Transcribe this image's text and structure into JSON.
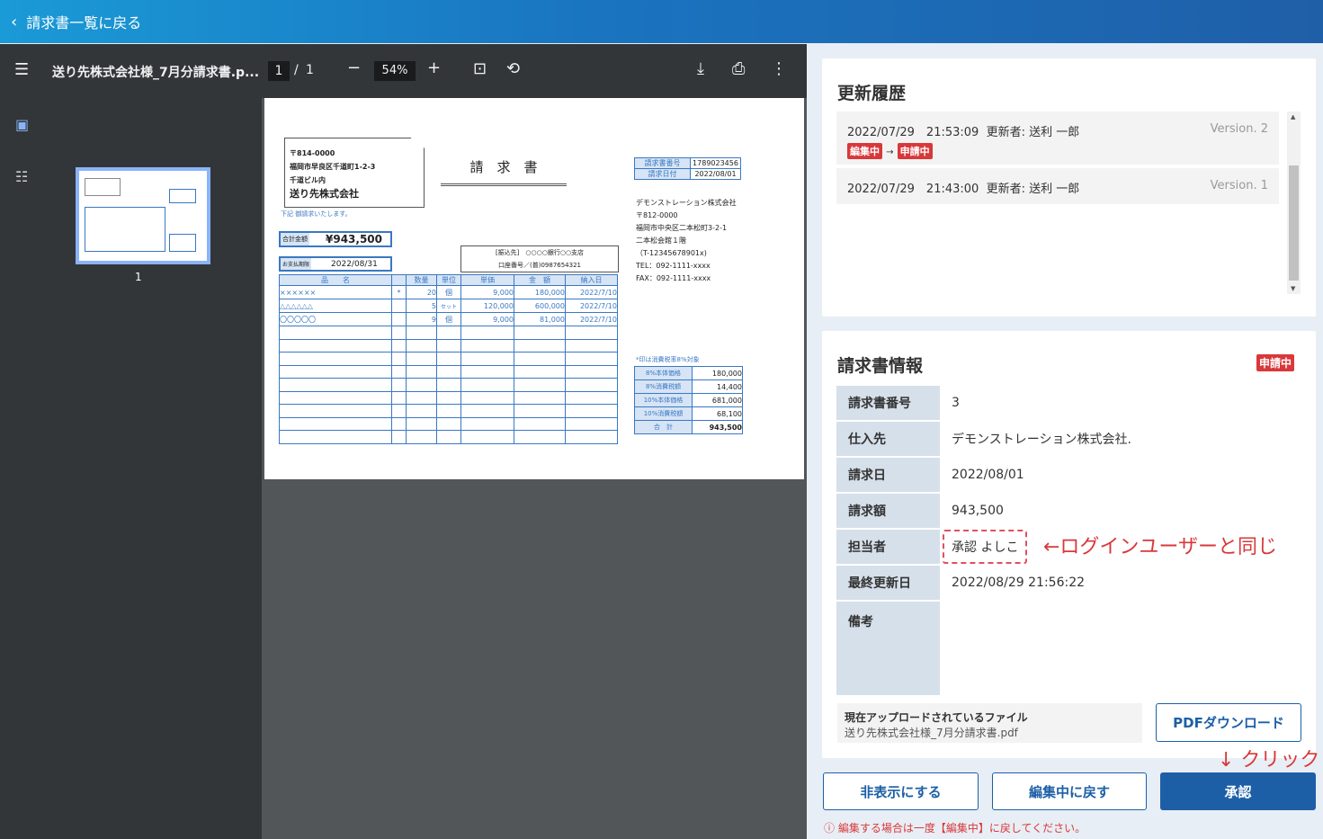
{
  "header": {
    "back_label": "請求書一覧に戻る"
  },
  "viewer": {
    "filename": "送り先株式会社様_7月分請求書.p...",
    "page": "1",
    "page_sep": "/",
    "total": "1",
    "zoom": "54%",
    "thumb_no": "1"
  },
  "invoice": {
    "postal": "〒814-0000",
    "addr1": "福岡市早良区千道町1-2-3",
    "addr2": "千道ビル内",
    "recipient": "送り先株式会社",
    "title": "請　求　書",
    "note": "下記 御請求いたします。",
    "total_label": "合計金額",
    "total": "¥943,500",
    "pay_label": "お支払期限",
    "pay_date": "2022/08/31",
    "bank": "[振込先]　○○○○銀行○○支店",
    "account": "口座番号／(普)0987654321",
    "meta": [
      [
        "請求書番号",
        "1789023456"
      ],
      [
        "請求日付",
        "2022/08/01"
      ]
    ],
    "sender": [
      "デモンストレーション株式会社",
      "〒812-0000",
      "福岡市中央区二本松町3-2-1",
      "二本松会館１階",
      "（T-12345678901x)",
      "TEL：092-1111-xxxx",
      "FAX：092-1111-xxxx"
    ],
    "cols": [
      "品　　名",
      "",
      "数量",
      "単位",
      "単価",
      "金　額",
      "納入日"
    ],
    "rows": [
      [
        "××××××",
        "*",
        "20",
        "個",
        "9,000",
        "180,000",
        "2022/7/10"
      ],
      [
        "△△△△△△",
        "",
        "5",
        "セット",
        "120,000",
        "600,000",
        "2022/7/10"
      ],
      [
        "〇〇〇〇〇",
        "",
        "9",
        "個",
        "9,000",
        "81,000",
        "2022/7/10"
      ]
    ],
    "tax_note": "*印は消費税率8%対象",
    "summary": [
      [
        "8%本体価格",
        "180,000"
      ],
      [
        "8%消費税額",
        "14,400"
      ],
      [
        "10%本体価格",
        "681,000"
      ],
      [
        "10%消費税額",
        "68,100"
      ],
      [
        "合　計",
        "943,500"
      ]
    ]
  },
  "history": {
    "title": "更新履歴",
    "items": [
      {
        "date": "2022/07/29　21:53:09",
        "updater": "更新者: 送利 一郎",
        "version": "Version. 2",
        "from": "編集中",
        "arrow": "→",
        "to": "申請中"
      },
      {
        "date": "2022/07/29　21:43:00",
        "updater": "更新者: 送利 一郎",
        "version": "Version. 1"
      }
    ]
  },
  "info": {
    "title": "請求書情報",
    "status": "申請中",
    "labels": [
      "請求書番号",
      "仕入先",
      "請求日",
      "請求額",
      "担当者",
      "最終更新日",
      "備考"
    ],
    "values": [
      "3",
      "デモンストレーション株式会社.",
      "2022/08/01",
      "943,500",
      "承認 よしこ",
      "2022/08/29 21:56:22",
      ""
    ],
    "annotation": "←ログインユーザーと同じ",
    "file_label": "現在アップロードされているファイル",
    "file_name": "送り先株式会社様_7月分請求書.pdf",
    "download": "PDFダウンロード"
  },
  "actions": {
    "click_note": "↓ クリック",
    "hide": "非表示にする",
    "revert": "編集中に戻す",
    "approve": "承認",
    "warning": "ⓘ 編集する場合は一度【編集中】に戻してください。"
  }
}
